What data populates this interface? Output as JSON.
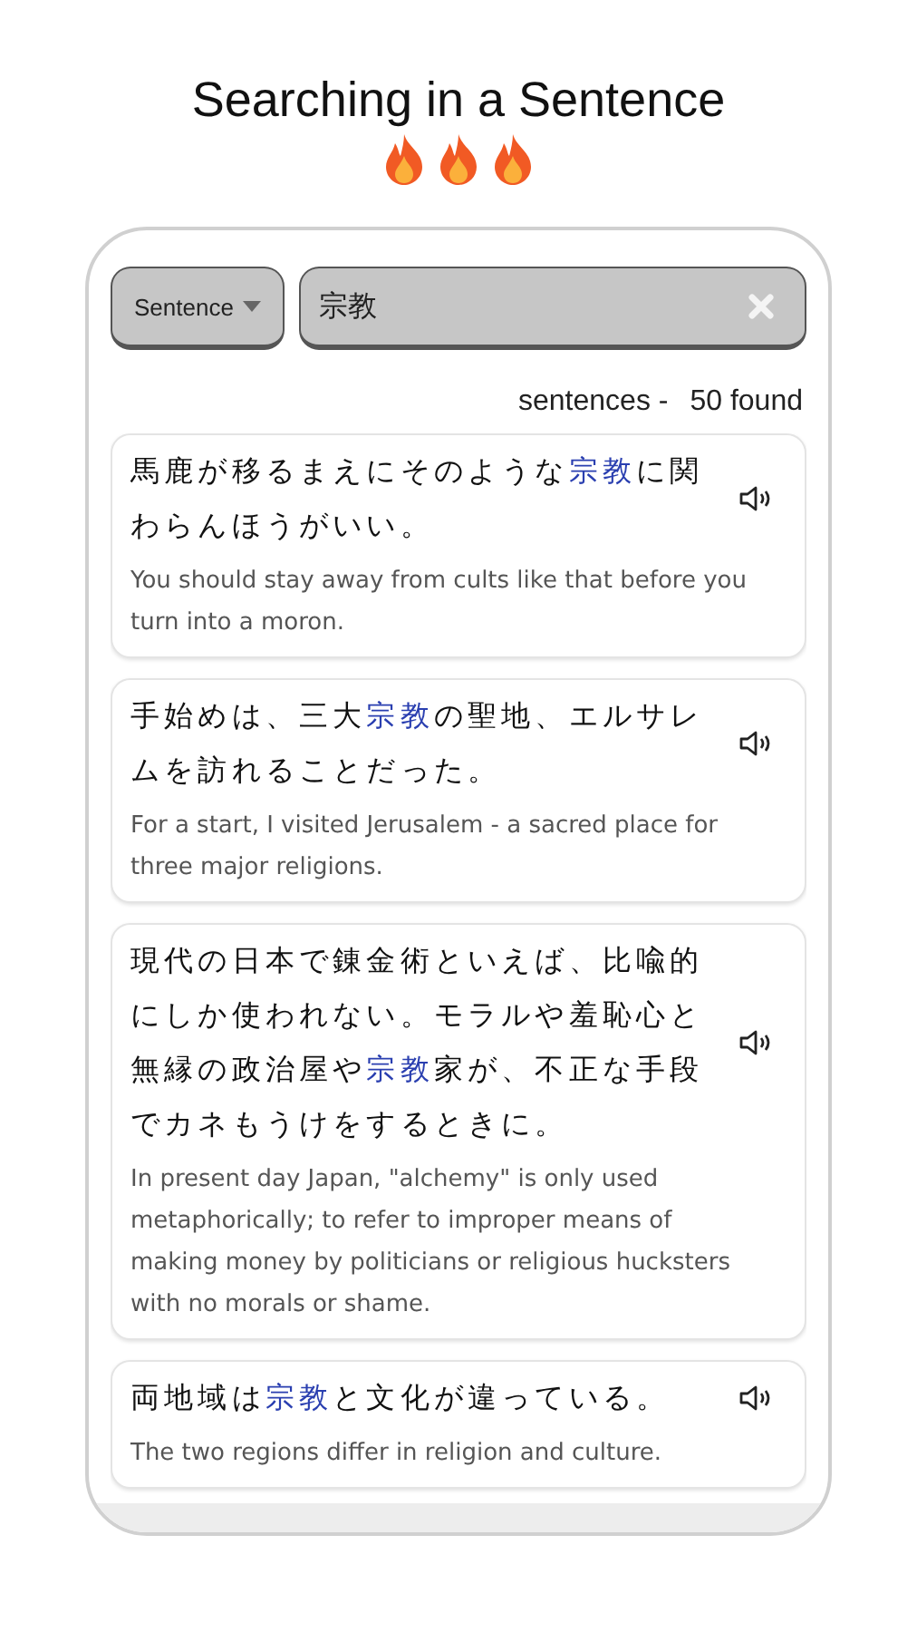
{
  "title": "Searching in a Sentence",
  "search": {
    "mode": "Sentence",
    "value": "宗教"
  },
  "result_count": {
    "label": "sentences -",
    "count": "50 found"
  },
  "sentences": [
    {
      "jp_before": "馬鹿が移るまえにそのような",
      "jp_match": "宗教",
      "jp_after": "に関わらんほうがいい。",
      "en": "You should stay away from cults like that before you turn into a moron."
    },
    {
      "jp_before": "手始めは、三大",
      "jp_match": "宗教",
      "jp_after": "の聖地、エルサレムを訪れることだった。",
      "en": "For a start, I visited Jerusalem - a sacred place for three major religions."
    },
    {
      "jp_before": "現代の日本で錬金術といえば、比喩的にしか使われない。モラルや羞恥心と無縁の政治屋や",
      "jp_match": "宗教",
      "jp_after": "家が、不正な手段でカネもうけをするときに。",
      "en": "In present day Japan, \"alchemy\" is only used metaphorically; to refer to improper means of making money by politicians or religious hucksters with no morals or shame."
    },
    {
      "jp_before": "両地域は",
      "jp_match": "宗教",
      "jp_after": "と文化が違っている。",
      "en": "The two regions differ in religion and culture."
    }
  ]
}
